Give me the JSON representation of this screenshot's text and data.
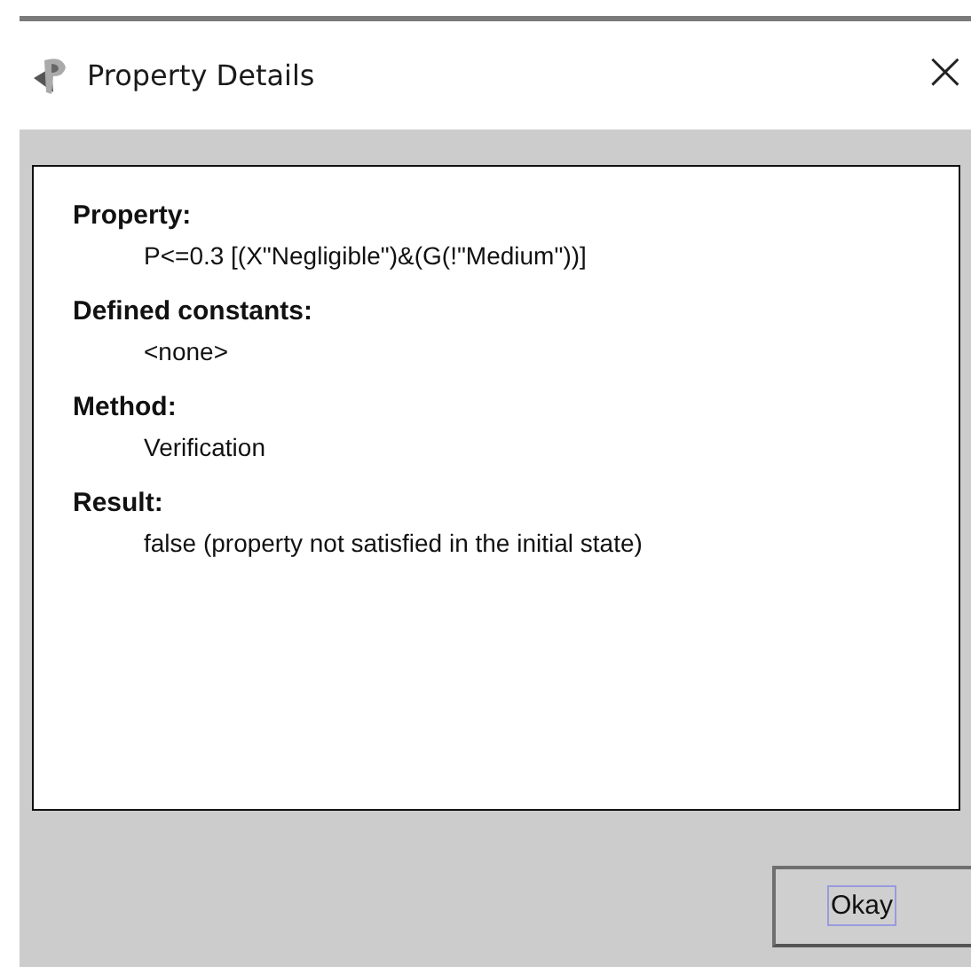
{
  "window": {
    "title": "Property Details",
    "close": "×"
  },
  "sections": [
    {
      "heading": "Property:",
      "value": "P<=0.3 [(X\"Negligible\")&(G(!\"Medium\"))]"
    },
    {
      "heading": "Defined constants:",
      "value": "<none>"
    },
    {
      "heading": "Method:",
      "value": "Verification"
    },
    {
      "heading": "Result:",
      "value": "false (property not satisfied in the initial state)"
    }
  ],
  "buttons": [
    {
      "label": "Okay",
      "focused": true
    }
  ]
}
